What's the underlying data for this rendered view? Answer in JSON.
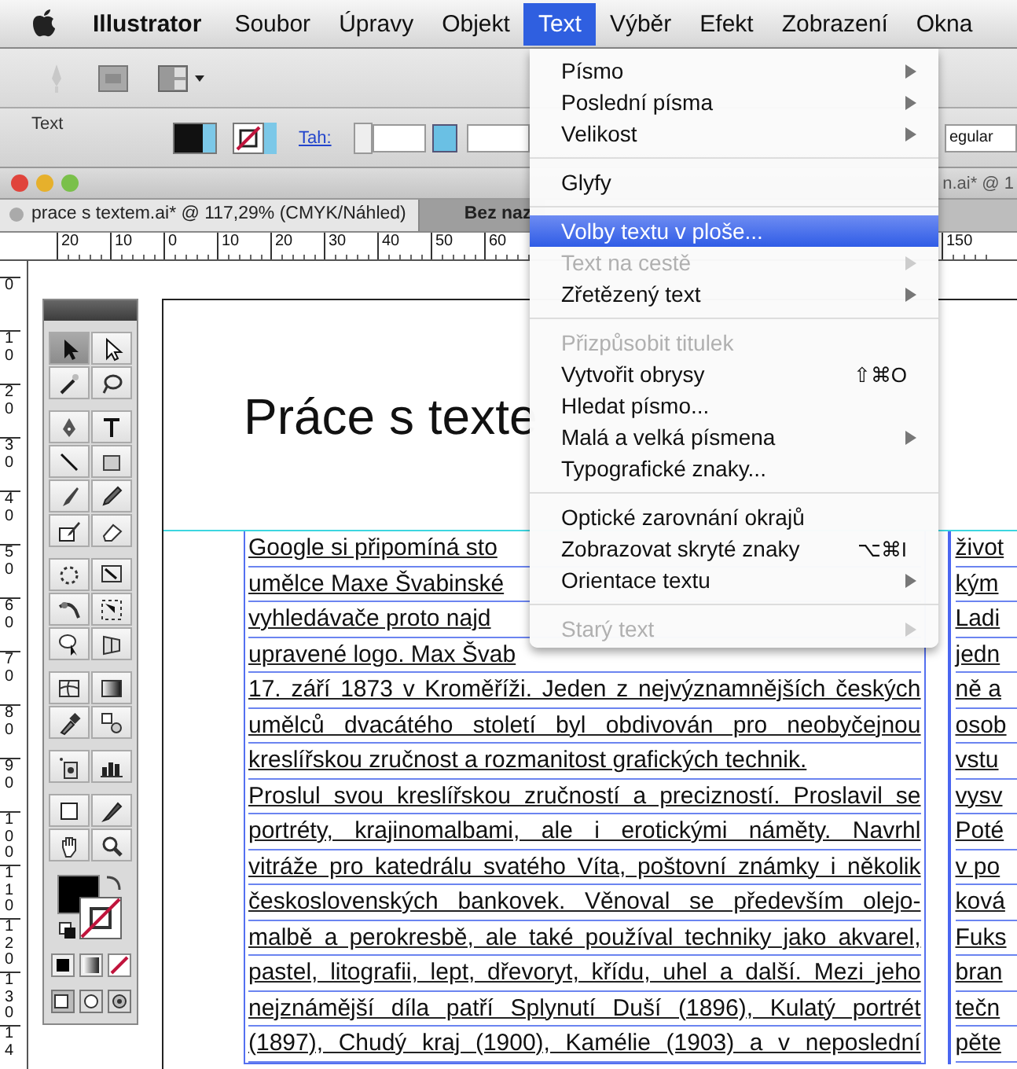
{
  "menubar": {
    "app": "Illustrator",
    "items": [
      {
        "label": "Soubor",
        "selected": false
      },
      {
        "label": "Úpravy",
        "selected": false
      },
      {
        "label": "Objekt",
        "selected": false
      },
      {
        "label": "Text",
        "selected": true
      },
      {
        "label": "Výběr",
        "selected": false
      },
      {
        "label": "Efekt",
        "selected": false
      },
      {
        "label": "Zobrazení",
        "selected": false
      },
      {
        "label": "Okna",
        "selected": false
      }
    ]
  },
  "control_bar": {
    "label": "Text",
    "stroke_link": "Tah:",
    "font_style": "egular"
  },
  "document_window": {
    "title": "n.ai* @ 1",
    "tabs": [
      {
        "label": "prace s textem.ai* @ 117,29% (CMYK/Náhled)",
        "selected": true
      },
      {
        "label": "Bez naz",
        "selected": false
      }
    ]
  },
  "ruler": {
    "left_labels": [
      "20",
      "10",
      "0",
      "10",
      "20",
      "30",
      "40",
      "50",
      "60"
    ],
    "right_labels": [
      "150"
    ]
  },
  "vertical_ruler": {
    "labels": [
      "0",
      "10",
      "20",
      "30",
      "40",
      "50",
      "60",
      "70",
      "80",
      "90",
      "100",
      "110",
      "120",
      "130",
      "14"
    ]
  },
  "toolbox": {
    "groups": [
      {
        "tools": [
          {
            "selected": true
          },
          {
            "selected": false
          },
          {
            "selected": false
          },
          {
            "selected": false
          }
        ]
      },
      {
        "tools": [
          {
            "selected": false
          },
          {
            "selected": false
          },
          {
            "selected": false
          },
          {
            "selected": false
          },
          {
            "selected": false
          },
          {
            "selected": false
          },
          {
            "selected": false
          },
          {
            "selected": false
          }
        ]
      },
      {
        "tools": [
          {
            "selected": false
          },
          {
            "selected": false
          },
          {
            "selected": false
          },
          {
            "selected": false
          },
          {
            "selected": false
          },
          {
            "selected": false
          }
        ]
      },
      {
        "tools": [
          {
            "selected": false
          },
          {
            "selected": false
          },
          {
            "selected": false
          },
          {
            "selected": false
          }
        ]
      },
      {
        "tools": [
          {
            "selected": false
          },
          {
            "selected": false
          }
        ]
      },
      {
        "tools": [
          {
            "selected": false
          },
          {
            "selected": false
          },
          {
            "selected": false
          },
          {
            "selected": false
          }
        ]
      }
    ]
  },
  "artboard": {
    "heading": "Práce s texte",
    "columns": [
      {
        "lines": [
          {
            "text": "Google si připomíná sto",
            "kind": "partial"
          },
          {
            "text": "umělce Maxe Švabinské",
            "kind": "partial"
          },
          {
            "text": "vyhledávače proto najd",
            "kind": "partial"
          },
          {
            "text": "upravené logo. Max Švab",
            "kind": "partial"
          },
          {
            "text": "17. září 1873 v Kroměříži. Jeden z nejvýznamnějších českých",
            "kind": "justified"
          },
          {
            "text": "umělců dvacátého století byl obdivován pro neobyčejnou",
            "kind": "justified"
          },
          {
            "text": "kreslířskou zručnost a rozmanitost grafických technik.",
            "kind": "last"
          },
          {
            "text": "Proslul svou kreslířskou zručností a precizností. Proslavil se",
            "kind": "justified"
          },
          {
            "text": "portréty, krajinomalbami, ale i erotickými náměty. Navrhl",
            "kind": "justified"
          },
          {
            "text": "vitráže pro katedrálu svatého Víta, poštovní známky i několik",
            "kind": "justified"
          },
          {
            "text": "československých bankovek. Věnoval se především olejo-",
            "kind": "justified"
          },
          {
            "text": "malbě a perokresbě, ale také používal techniky jako akvarel,",
            "kind": "justified"
          },
          {
            "text": "pastel, litografii, lept, dřevoryt, křídu, uhel a další. Mezi jeho",
            "kind": "justified"
          },
          {
            "text": "nejznámější díla patří Splynutí Duší (1896), Kulatý portrét",
            "kind": "justified"
          },
          {
            "text": "(1897), Chudý kraj (1900), Kamélie (1903) a v neposlední",
            "kind": "justified"
          }
        ]
      },
      {
        "lines": [
          {
            "text": "život",
            "kind": "partial"
          },
          {
            "text": "kým",
            "kind": "partial"
          },
          {
            "text": "Ladi",
            "kind": "partial"
          },
          {
            "text": "jedn",
            "kind": "partial"
          },
          {
            "text": "ně a",
            "kind": "partial"
          },
          {
            "text": "osob",
            "kind": "partial"
          },
          {
            "text": "vstu",
            "kind": "partial"
          },
          {
            "text": "vysv",
            "kind": "partial"
          },
          {
            "text": "Poté",
            "kind": "partial"
          },
          {
            "text": "v po",
            "kind": "partial"
          },
          {
            "text": "ková",
            "kind": "partial"
          },
          {
            "text": "Fuks",
            "kind": "partial"
          },
          {
            "text": "bran",
            "kind": "partial"
          },
          {
            "text": "tečn",
            "kind": "partial"
          },
          {
            "text": "pěte",
            "kind": "partial"
          }
        ]
      }
    ]
  },
  "text_menu": {
    "items": [
      {
        "kind": "item",
        "label": "Písmo",
        "selected": false,
        "disabled": false,
        "submenu": true
      },
      {
        "kind": "item",
        "label": "Poslední písma",
        "selected": false,
        "disabled": false,
        "submenu": true
      },
      {
        "kind": "item",
        "label": "Velikost",
        "selected": false,
        "disabled": false,
        "submenu": true
      },
      {
        "kind": "separator"
      },
      {
        "kind": "item",
        "label": "Glyfy",
        "selected": false,
        "disabled": false,
        "submenu": false
      },
      {
        "kind": "separator"
      },
      {
        "kind": "item",
        "label": "Volby textu v ploše...",
        "selected": true,
        "disabled": false,
        "submenu": false
      },
      {
        "kind": "item",
        "label": "Text na cestě",
        "selected": false,
        "disabled": true,
        "submenu": true
      },
      {
        "kind": "item",
        "label": "Zřetězený text",
        "selected": false,
        "disabled": false,
        "submenu": true
      },
      {
        "kind": "separator"
      },
      {
        "kind": "item",
        "label": "Přizpůsobit titulek",
        "selected": false,
        "disabled": true,
        "submenu": false
      },
      {
        "kind": "item",
        "label": "Vytvořit obrysy",
        "selected": false,
        "disabled": false,
        "submenu": false,
        "shortcut": "⇧⌘O"
      },
      {
        "kind": "item",
        "label": "Hledat písmo...",
        "selected": false,
        "disabled": false,
        "submenu": false
      },
      {
        "kind": "item",
        "label": "Malá a velká písmena",
        "selected": false,
        "disabled": false,
        "submenu": true
      },
      {
        "kind": "item",
        "label": "Typografické znaky...",
        "selected": false,
        "disabled": false,
        "submenu": false
      },
      {
        "kind": "separator"
      },
      {
        "kind": "item",
        "label": "Optické zarovnání okrajů",
        "selected": false,
        "disabled": false,
        "submenu": false
      },
      {
        "kind": "item",
        "label": "Zobrazovat skryté znaky",
        "selected": false,
        "disabled": false,
        "submenu": false,
        "shortcut": "⌥⌘I"
      },
      {
        "kind": "item",
        "label": "Orientace textu",
        "selected": false,
        "disabled": false,
        "submenu": true
      },
      {
        "kind": "separator"
      },
      {
        "kind": "item",
        "label": "Starý text",
        "selected": false,
        "disabled": true,
        "submenu": true
      }
    ]
  }
}
